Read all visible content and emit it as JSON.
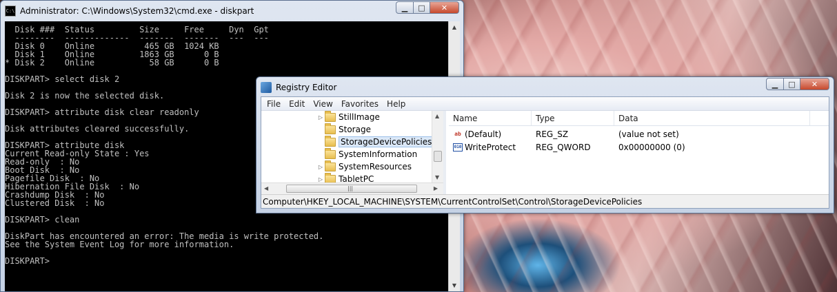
{
  "cmd": {
    "title": "Administrator: C:\\Windows\\System32\\cmd.exe - diskpart",
    "icon_label": "C:\\",
    "lines": [
      "  Disk ###  Status         Size     Free     Dyn  Gpt",
      "  --------  -------------  -------  -------  ---  ---",
      "  Disk 0    Online          465 GB  1024 KB",
      "  Disk 1    Online         1863 GB      0 B",
      "* Disk 2    Online           58 GB      0 B",
      "",
      "DISKPART> select disk 2",
      "",
      "Disk 2 is now the selected disk.",
      "",
      "DISKPART> attribute disk clear readonly",
      "",
      "Disk attributes cleared successfully.",
      "",
      "DISKPART> attribute disk",
      "Current Read-only State : Yes",
      "Read-only  : No",
      "Boot Disk  : No",
      "Pagefile Disk  : No",
      "Hibernation File Disk  : No",
      "Crashdump Disk  : No",
      "Clustered Disk  : No",
      "",
      "DISKPART> clean",
      "",
      "DiskPart has encountered an error: The media is write protected.",
      "See the System Event Log for more information.",
      "",
      "DISKPART>"
    ]
  },
  "regedit": {
    "title": "Registry Editor",
    "menu": [
      "File",
      "Edit",
      "View",
      "Favorites",
      "Help"
    ],
    "tree": [
      {
        "label": "StillImage",
        "expander": "▷",
        "selected": false
      },
      {
        "label": "Storage",
        "expander": "",
        "selected": false
      },
      {
        "label": "StorageDevicePolicies",
        "expander": "",
        "selected": true
      },
      {
        "label": "SystemInformation",
        "expander": "",
        "selected": false
      },
      {
        "label": "SystemResources",
        "expander": "▷",
        "selected": false
      },
      {
        "label": "TabletPC",
        "expander": "▷",
        "selected": false
      }
    ],
    "columns": {
      "name": "Name",
      "type": "Type",
      "data": "Data"
    },
    "values": [
      {
        "icon": "string-value-icon",
        "icon_text": "ab",
        "name": "(Default)",
        "type": "REG_SZ",
        "data": "(value not set)"
      },
      {
        "icon": "binary-value-icon",
        "icon_text": "010",
        "name": "WriteProtect",
        "type": "REG_QWORD",
        "data": "0x00000000 (0)"
      }
    ],
    "status_path": "Computer\\HKEY_LOCAL_MACHINE\\SYSTEM\\CurrentControlSet\\Control\\StorageDevicePolicies",
    "scroll_glyphs": {
      "up": "▲",
      "down": "▼",
      "left": "◀",
      "right": "▶",
      "grip": "|||"
    }
  },
  "window_controls": {
    "minimize": "▁",
    "maximize": "□",
    "close": "✕"
  }
}
